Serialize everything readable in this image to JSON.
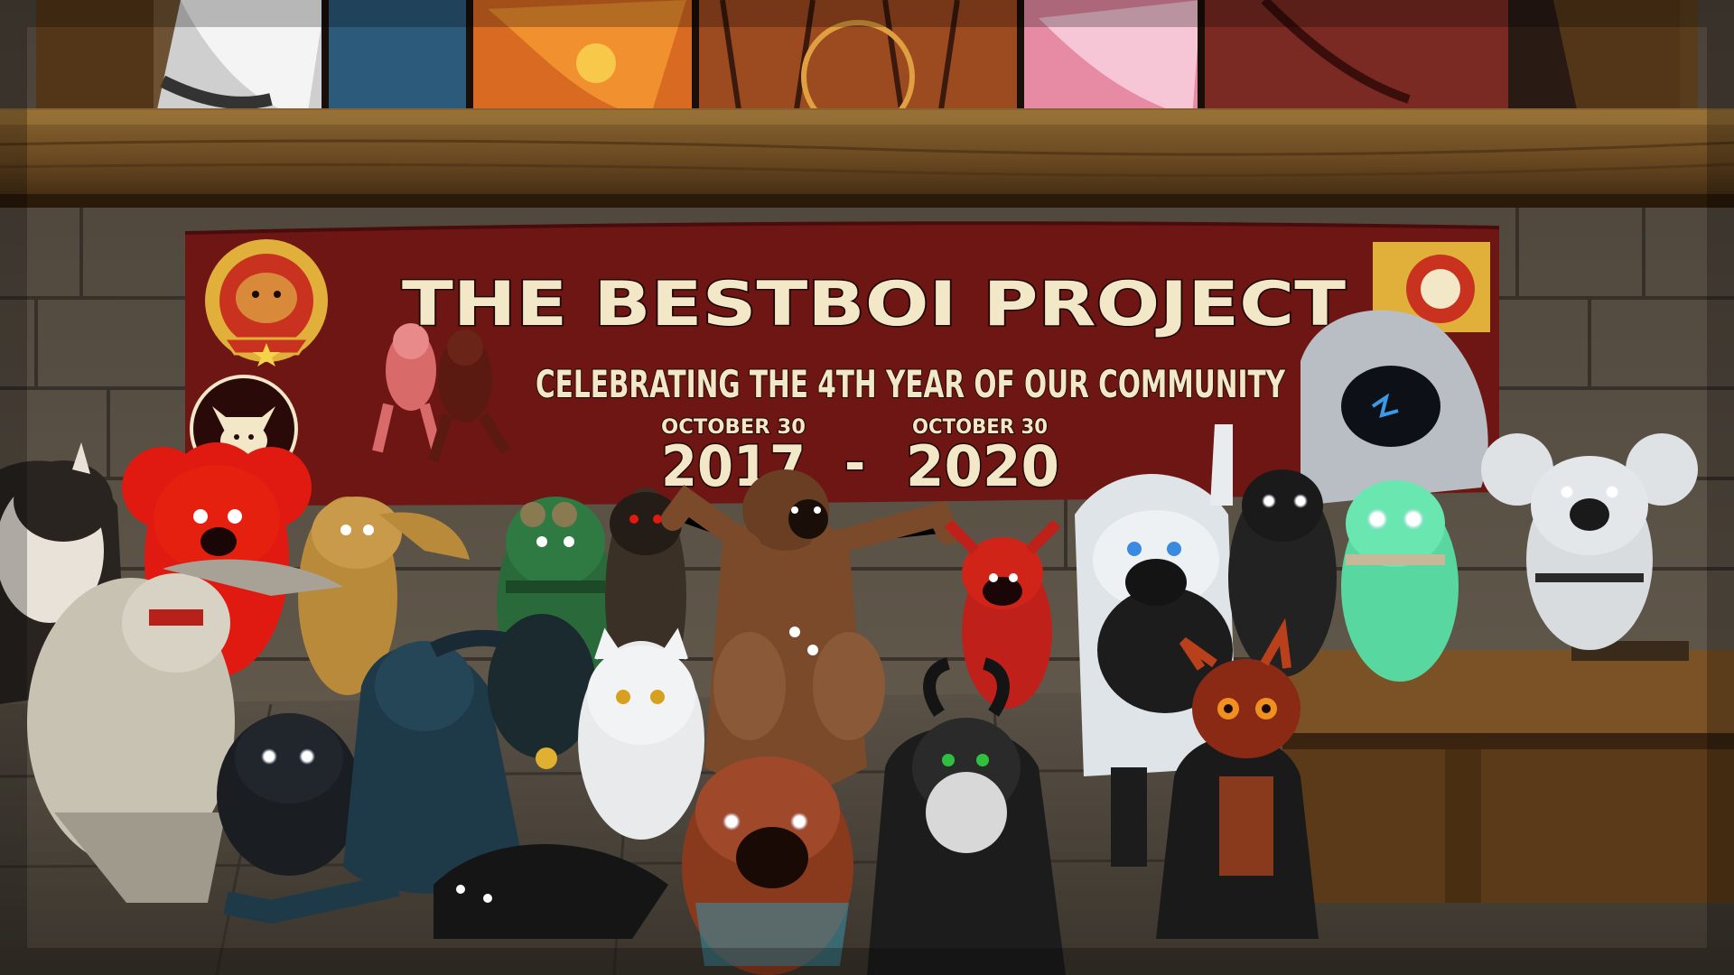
{
  "banner": {
    "title": "THE BESTBOI PROJECT",
    "subtitle": "CELEBRATING THE 4TH YEAR OF OUR COMMUNITY",
    "start_date": "OCTOBER 30",
    "end_date": "OCTOBER 30",
    "start_year": "2017",
    "separator": "-",
    "end_year": "2020"
  },
  "colors": {
    "banner": "#6e1613",
    "banner_text": "#f2e7c6",
    "wood": "#6b4a22",
    "stone": "#6f675a"
  }
}
